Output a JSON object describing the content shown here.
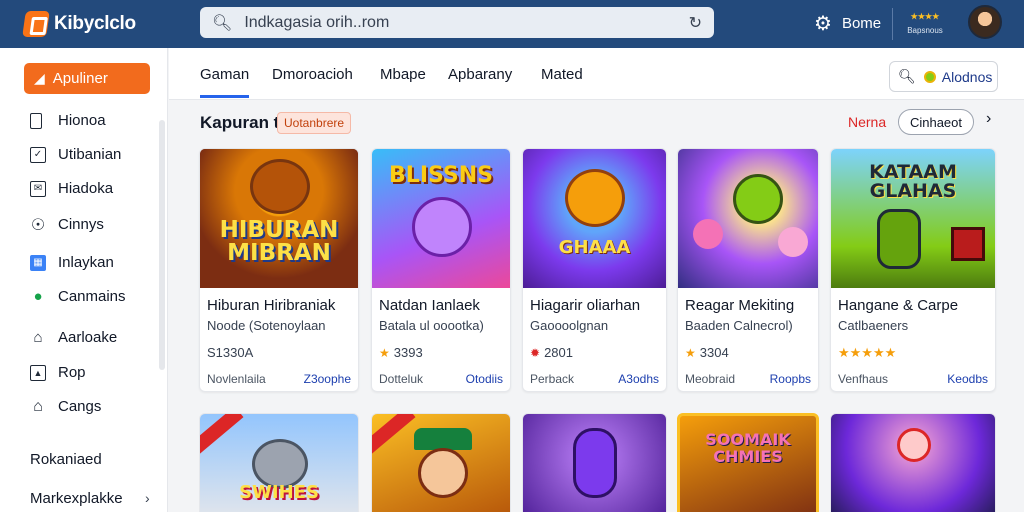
{
  "app": {
    "name": "Kibyclclo"
  },
  "search": {
    "value": "Indkagasia orih..rom"
  },
  "header": {
    "settings_label": "Bome",
    "badge_line1": "★★★★",
    "badge_line2": "Bapsnous"
  },
  "sidebar": {
    "primary_label": "Apuliner",
    "items": [
      {
        "label": "Hionoa",
        "icon": "page-icon"
      },
      {
        "label": "Utibanian",
        "icon": "checkbox-icon"
      },
      {
        "label": "Hiadoka",
        "icon": "mail-icon"
      },
      {
        "label": "Cinnys",
        "icon": "compass-icon"
      },
      {
        "label": "Inlaykan",
        "icon": "grid-icon"
      },
      {
        "label": "Canmains",
        "icon": "globe-icon"
      },
      {
        "label": "Aarloake",
        "icon": "home-icon"
      },
      {
        "label": "Rop",
        "icon": "image-icon"
      },
      {
        "label": "Cangs",
        "icon": "house-icon"
      }
    ],
    "section_label": "Rokaniaed",
    "bottom_item": "Markexplakke"
  },
  "tabs": [
    "Gaman",
    "Dmoroacioh",
    "Mbape",
    "Apbarany",
    "Mated"
  ],
  "filter_label": "Alodnos",
  "section": {
    "title": "Kapuran t",
    "tag": "Uotanbrere",
    "link": "Nerna",
    "button": "Cinhaeot"
  },
  "cards": [
    {
      "title": "Hiburan Hiribraniak",
      "subtitle": "Noode (Sotenoylaan",
      "rating": "S1330A",
      "foot_left": "Novlenlaila",
      "foot_right": "Z3oophe",
      "art": "HIBURAN MIBRAN"
    },
    {
      "title": "Natdan Ianlaek",
      "subtitle": "Batala ul ooootka)",
      "rating": "3393",
      "foot_left": "Dotteluk",
      "foot_right": "Otodiis",
      "art": "BLISSNS"
    },
    {
      "title": "Hiagarir oliarhan",
      "subtitle": "Gaoooolgnan",
      "rating": "2801",
      "foot_left": "Perback",
      "foot_right": "A3odhs",
      "art": "GHAAA"
    },
    {
      "title": "Reagar Mekiting",
      "subtitle": "Baaden Calnecrol)",
      "rating": "3304",
      "foot_left": "Meobraid",
      "foot_right": "Roopbs",
      "art": ""
    },
    {
      "title": "Hangane & Carpe",
      "subtitle": "Catlbaeners",
      "rating": "★★★★★",
      "foot_left": "Venfhaus",
      "foot_right": "Keodbs",
      "art": "KATAAM GLAHAS"
    }
  ],
  "row2": [
    {
      "art": "SWIHES"
    },
    {
      "art": ""
    },
    {
      "art": ""
    },
    {
      "art": "SOOMAIK CHMIES"
    },
    {
      "art": ""
    }
  ]
}
